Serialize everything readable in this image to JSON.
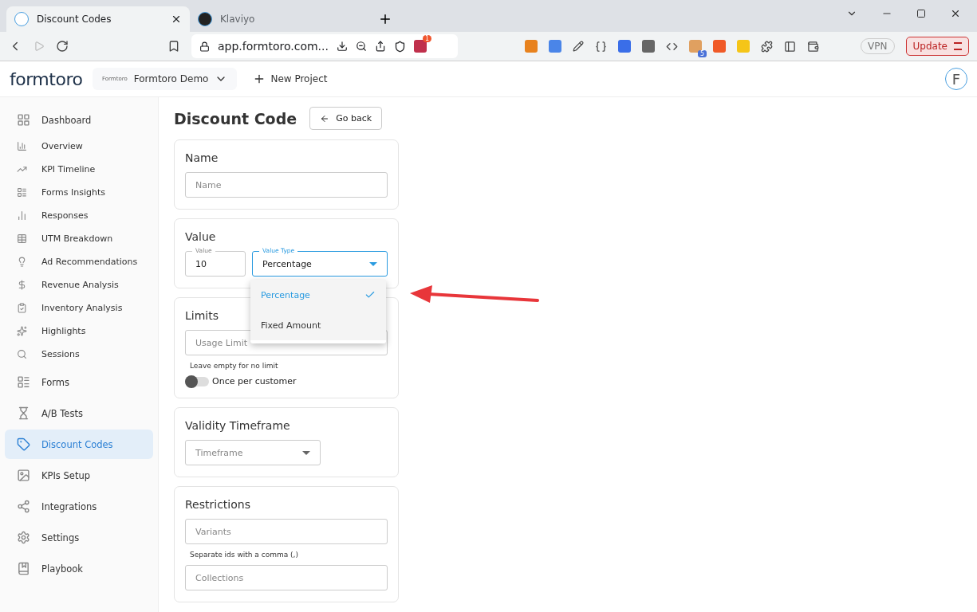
{
  "browser": {
    "tabs": [
      {
        "title": "Discount Codes",
        "selected": true
      },
      {
        "title": "Klaviyo",
        "selected": false
      }
    ],
    "address": "app.formtoro.com...",
    "rewards_badge": "1",
    "extension_badge": "5",
    "vpn": "VPN",
    "update": "Update"
  },
  "header": {
    "logo": "formtoro",
    "project_logo_text": "Formtoro",
    "project": "Formtoro Demo",
    "new_project": "New Project",
    "avatar": "F"
  },
  "sidebar": {
    "items": [
      {
        "label": "Dashboard",
        "kind": "section",
        "selected": false
      },
      {
        "label": "Overview",
        "kind": "sub",
        "selected": false
      },
      {
        "label": "KPI Timeline",
        "kind": "sub",
        "selected": false
      },
      {
        "label": "Forms Insights",
        "kind": "sub",
        "selected": false
      },
      {
        "label": "Responses",
        "kind": "sub",
        "selected": false
      },
      {
        "label": "UTM Breakdown",
        "kind": "sub",
        "selected": false
      },
      {
        "label": "Ad Recommendations",
        "kind": "sub",
        "selected": false
      },
      {
        "label": "Revenue Analysis",
        "kind": "sub",
        "selected": false
      },
      {
        "label": "Inventory Analysis",
        "kind": "sub",
        "selected": false
      },
      {
        "label": "Highlights",
        "kind": "sub",
        "selected": false
      },
      {
        "label": "Sessions",
        "kind": "sub",
        "selected": false
      },
      {
        "label": "Forms",
        "kind": "section",
        "selected": false
      },
      {
        "label": "A/B Tests",
        "kind": "section",
        "selected": false
      },
      {
        "label": "Discount Codes",
        "kind": "section",
        "selected": true
      },
      {
        "label": "KPIs Setup",
        "kind": "section",
        "selected": false
      },
      {
        "label": "Integrations",
        "kind": "section",
        "selected": false
      },
      {
        "label": "Settings",
        "kind": "section",
        "selected": false
      },
      {
        "label": "Playbook",
        "kind": "section",
        "selected": false
      }
    ]
  },
  "page": {
    "title": "Discount Code",
    "back": "Go back"
  },
  "name_card": {
    "title": "Name",
    "placeholder": "Name"
  },
  "value_card": {
    "title": "Value",
    "value_label": "Value",
    "value": "10",
    "type_label": "Value Type",
    "type_value": "Percentage",
    "options": [
      {
        "label": "Percentage",
        "selected": true
      },
      {
        "label": "Fixed Amount",
        "selected": false
      }
    ]
  },
  "limits_card": {
    "title": "Limits",
    "placeholder": "Usage Limit",
    "helper": "Leave empty for no limit",
    "toggle_label": "Once per customer",
    "on": false
  },
  "validity_card": {
    "title": "Validity Timeframe",
    "placeholder": "Timeframe"
  },
  "restrictions_card": {
    "title": "Restrictions",
    "variants_placeholder": "Variants",
    "helper": "Separate ids with a comma (,)",
    "collections_placeholder": "Collections"
  }
}
